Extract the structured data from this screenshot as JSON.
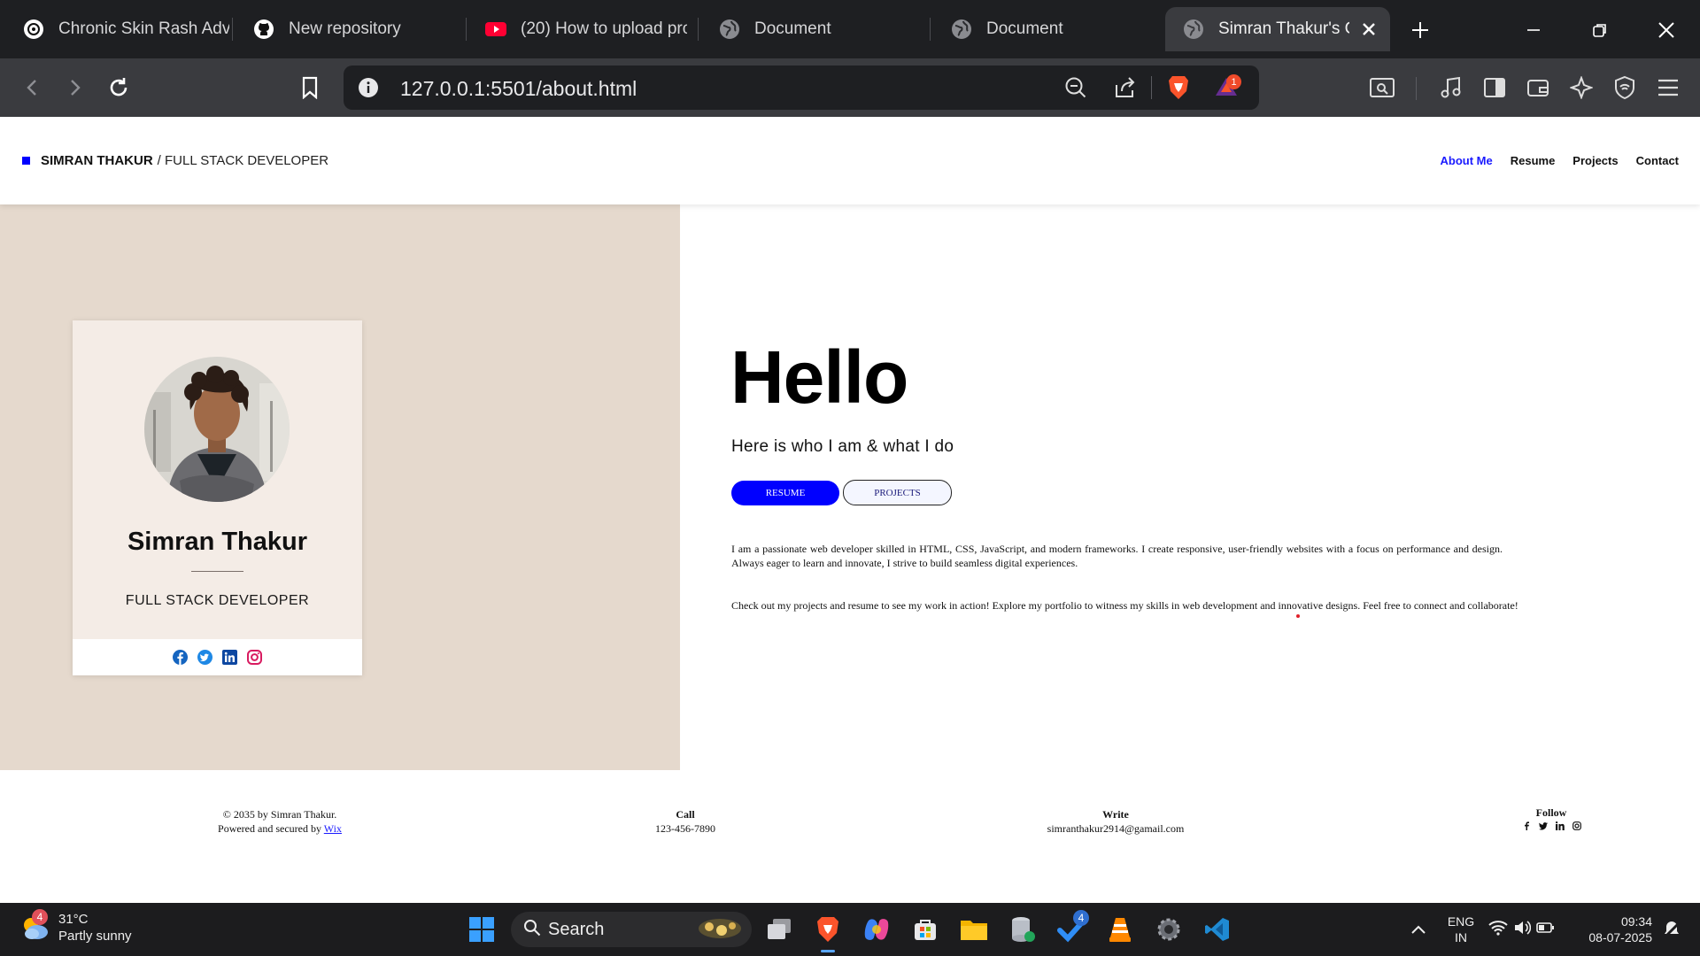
{
  "browser": {
    "tabs": [
      {
        "title": "Chronic Skin Rash Advi",
        "icon": "chatgpt-icon"
      },
      {
        "title": "New repository",
        "icon": "github-icon"
      },
      {
        "title": "(20) How to upload pro",
        "icon": "youtube-icon"
      },
      {
        "title": "Document",
        "icon": "globe-icon"
      },
      {
        "title": "Document",
        "icon": "globe-icon"
      },
      {
        "title": "Simran Thakur's C",
        "icon": "globe-icon",
        "active": true
      }
    ],
    "url": "127.0.0.1:5501/about.html",
    "notification_count": "1",
    "brave_orange": "#fb542b"
  },
  "site": {
    "brand_name": "SIMRAN THAKUR",
    "brand_role": "/ FULL STACK DEVELOPER",
    "nav": [
      "About Me",
      "Resume",
      "Projects",
      "Contact"
    ],
    "accent": "#0000ff",
    "left_bg": "#e5d9cd"
  },
  "card": {
    "name": "Simran Thakur",
    "role": "FULL STACK DEVELOPER",
    "social": [
      "facebook-icon",
      "twitter-icon",
      "linkedin-icon",
      "instagram-icon"
    ]
  },
  "hero": {
    "heading": "Hello",
    "tagline": "Here is who I am & what I do",
    "btn_resume": "RESUME",
    "btn_projects": "PROJECTS",
    "para1": "I am a passionate web developer skilled in HTML, CSS, JavaScript, and modern frameworks. I create responsive, user-friendly websites with a focus on performance and design. Always eager to learn and innovate, I strive to build seamless digital experiences.",
    "para2": "Check out my projects and resume to see my work in action! Explore my portfolio to witness my skills in web development and innovative designs. Feel free to connect and collaborate!"
  },
  "footer": {
    "copyright": "© 2035 by Simran Thakur.",
    "powered": "Powered and secured by",
    "powered_link": "Wix",
    "call_h": "Call",
    "call_v": "123-456-7890",
    "write_h": "Write",
    "write_v": "simranthakur2914@gamail.com",
    "follow_h": "Follow"
  },
  "taskbar": {
    "temp": "31°C",
    "condition": "Partly sunny",
    "weather_badge": "4",
    "search": "Search",
    "app_badge": "4",
    "lang1": "ENG",
    "lang2": "IN",
    "time": "09:34",
    "date": "08-07-2025"
  }
}
